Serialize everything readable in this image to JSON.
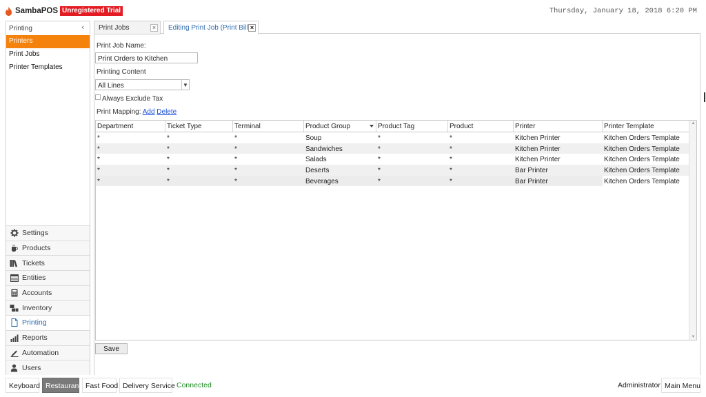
{
  "app": {
    "brand": "SambaPOS",
    "trial_badge": "Unregistered Trial",
    "datetime": "Thursday, January 18, 2018 6:20 PM"
  },
  "sidebar": {
    "header": "Printing",
    "collapse_glyph": "‹",
    "items": [
      {
        "label": "Printers",
        "active": true
      },
      {
        "label": "Print Jobs",
        "active": false
      },
      {
        "label": "Printer Templates",
        "active": false
      }
    ],
    "nav": [
      {
        "label": "Settings",
        "icon": "gear-icon"
      },
      {
        "label": "Products",
        "icon": "coffee-cup-icon"
      },
      {
        "label": "Tickets",
        "icon": "books-icon"
      },
      {
        "label": "Entities",
        "icon": "table-icon"
      },
      {
        "label": "Accounts",
        "icon": "calculator-icon"
      },
      {
        "label": "Inventory",
        "icon": "boxes-icon"
      },
      {
        "label": "Printing",
        "icon": "document-icon",
        "active": true
      },
      {
        "label": "Reports",
        "icon": "bar-chart-icon"
      },
      {
        "label": "Automation",
        "icon": "pencil-icon"
      },
      {
        "label": "Users",
        "icon": "user-icon"
      }
    ]
  },
  "tabs": [
    {
      "label": "Print Jobs",
      "close": "×"
    },
    {
      "label": "Editing Print Job (Print Bill)",
      "close": "×",
      "active": true
    }
  ],
  "form": {
    "name_label": "Print Job Name:",
    "name_value": "Print Orders to Kitchen",
    "content_label": "Printing Content",
    "content_value": "All Lines",
    "exclude_tax_label": "Always Exclude Tax",
    "mapping_label": "Print Mapping:",
    "add_link": "Add",
    "delete_link": "Delete",
    "save_label": "Save"
  },
  "grid": {
    "columns": [
      "Department",
      "Ticket Type",
      "Terminal",
      "Product Group",
      "Product Tag",
      "Product",
      "Printer",
      "Printer Template"
    ],
    "rows": [
      [
        "*",
        "*",
        "*",
        "Soup",
        "*",
        "*",
        "Kitchen Printer",
        "Kitchen Orders Template"
      ],
      [
        "*",
        "*",
        "*",
        "Sandwiches",
        "*",
        "*",
        "Kitchen Printer",
        "Kitchen Orders Template"
      ],
      [
        "*",
        "*",
        "*",
        "Salads",
        "*",
        "*",
        "Kitchen Printer",
        "Kitchen Orders Template"
      ],
      [
        "*",
        "*",
        "*",
        "Deserts",
        "*",
        "*",
        "Bar Printer",
        "Kitchen Orders Template"
      ],
      [
        "*",
        "*",
        "*",
        "Beverages",
        "*",
        "*",
        "Bar Printer",
        "Kitchen Orders Template"
      ]
    ]
  },
  "bottom": {
    "keyboard": "Keyboard",
    "restaurant": "Restaurant",
    "fast_food": "Fast Food",
    "delivery": "Delivery Service",
    "status": "Connected",
    "user": "Administrator",
    "main_menu": "Main Menu"
  },
  "colors": {
    "accent": "#f5820d",
    "badge": "#e31b23",
    "link": "#1a4fd6",
    "connected": "#1e8c23"
  }
}
